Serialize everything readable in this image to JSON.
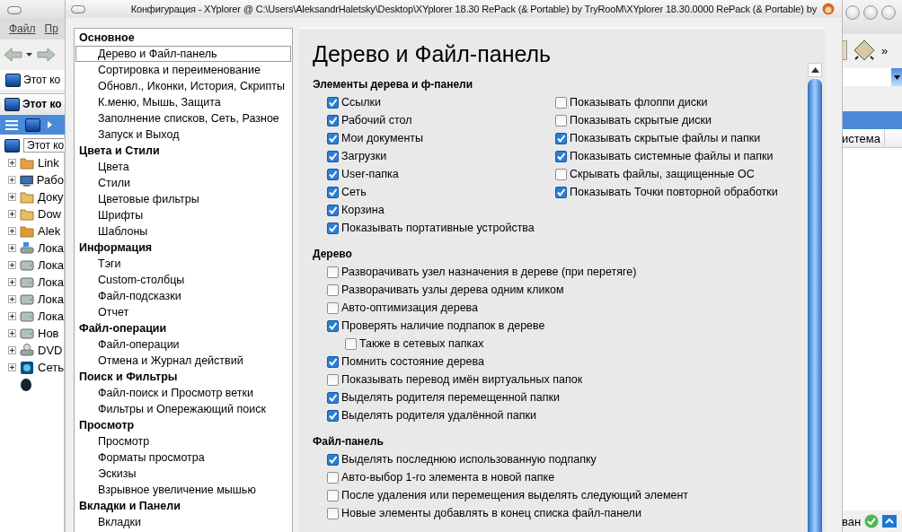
{
  "background_window": {
    "menu": [
      "Файл",
      "Пр"
    ],
    "address": "Этот ко",
    "tab": "Этот ко",
    "tree_root": "Этот ко",
    "tree": [
      {
        "label": "Link",
        "kind": "links"
      },
      {
        "label": "Рабо",
        "kind": "desktop"
      },
      {
        "label": "Доку",
        "kind": "documents"
      },
      {
        "label": "Dow",
        "kind": "downloads"
      },
      {
        "label": "Alek",
        "kind": "user"
      },
      {
        "label": "Лока",
        "kind": "system-drive"
      },
      {
        "label": "Лока",
        "kind": "drive"
      },
      {
        "label": "Лока",
        "kind": "drive"
      },
      {
        "label": "Лока",
        "kind": "drive"
      },
      {
        "label": "Лока",
        "kind": "drive"
      },
      {
        "label": "Нов",
        "kind": "drive"
      },
      {
        "label": "DVD",
        "kind": "dvd"
      },
      {
        "label": "Сеть",
        "kind": "network"
      }
    ],
    "toolbar_more": "»",
    "column_header": "истема",
    "status": "ван"
  },
  "dialog": {
    "title": "Конфигурация - XYplorer @ C:\\Users\\AleksandrHaletsky\\Desktop\\XYplorer 18.30 RePack (& Portable) by TryRooM\\XYplorer 18.30.0000 RePack (& Portable) by",
    "nav": [
      {
        "title": "Основное",
        "items": [
          {
            "label": "Дерево и Файл-панель",
            "selected": true
          },
          {
            "label": "Сортировка и переименование",
            "selected": false
          },
          {
            "label": "Обновл., Иконки, История, Скрипты",
            "selected": false
          },
          {
            "label": "К.меню, Мышь, Защита",
            "selected": false
          },
          {
            "label": "Заполнение списков, Сеть, Разное",
            "selected": false
          },
          {
            "label": "Запуск и Выход",
            "selected": false
          }
        ]
      },
      {
        "title": "Цвета и Стили",
        "items": [
          {
            "label": "Цвета",
            "selected": false
          },
          {
            "label": "Стили",
            "selected": false
          },
          {
            "label": "Цветовые фильтры",
            "selected": false
          },
          {
            "label": "Шрифты",
            "selected": false
          },
          {
            "label": "Шаблоны",
            "selected": false
          }
        ]
      },
      {
        "title": "Информация",
        "items": [
          {
            "label": "Тэги",
            "selected": false
          },
          {
            "label": "Custom-столбцы",
            "selected": false
          },
          {
            "label": "Файл-подсказки",
            "selected": false
          },
          {
            "label": "Отчет",
            "selected": false
          }
        ]
      },
      {
        "title": "Файл-операции",
        "items": [
          {
            "label": "Файл-операции",
            "selected": false
          },
          {
            "label": "Отмена и Журнал действий",
            "selected": false
          }
        ]
      },
      {
        "title": "Поиск и Фильтры",
        "items": [
          {
            "label": "Файл-поиск и Просмотр ветки",
            "selected": false
          },
          {
            "label": "Фильтры и Опережающий поиск",
            "selected": false
          }
        ]
      },
      {
        "title": "Просмотр",
        "items": [
          {
            "label": "Просмотр",
            "selected": false
          },
          {
            "label": "Форматы просмотра",
            "selected": false
          },
          {
            "label": "Эскизы",
            "selected": false
          },
          {
            "label": "Взрывное увеличение мышью",
            "selected": false
          }
        ]
      },
      {
        "title": "Вкладки и Панели",
        "items": [
          {
            "label": "Вкладки",
            "selected": false
          }
        ]
      }
    ],
    "heading": "Дерево и Файл-панель",
    "groups": [
      {
        "title": "Элементы дерева и ф-панели",
        "columns": [
          [
            {
              "label": "Ссылки",
              "checked": true
            },
            {
              "label": "Рабочий стол",
              "checked": true
            },
            {
              "label": "Мои документы",
              "checked": true
            },
            {
              "label": "Загрузки",
              "checked": true
            },
            {
              "label": "User-папка",
              "checked": true
            },
            {
              "label": "Сеть",
              "checked": true
            },
            {
              "label": "Корзина",
              "checked": true
            },
            {
              "label": "Показывать портативные устройства",
              "checked": true
            }
          ],
          [
            {
              "label": "Показывать флоппи диски",
              "checked": false
            },
            {
              "label": "Показывать скрытые диски",
              "checked": false
            },
            {
              "label": "Показывать скрытые файлы и папки",
              "checked": true
            },
            {
              "label": "Показывать системные файлы и папки",
              "checked": true
            },
            {
              "label": "Скрывать файлы, защищенные ОС",
              "checked": false
            },
            {
              "label": "Показывать Точки повторной обработки",
              "checked": true
            }
          ]
        ]
      },
      {
        "title": "Дерево",
        "columns": [
          [
            {
              "label": "Разворачивать узел назначения в дереве (при перетяге)",
              "checked": false
            },
            {
              "label": "Разворачивать узлы дерева одним кликом",
              "checked": false
            },
            {
              "label": "Авто-оптимизация дерева",
              "checked": false
            },
            {
              "label": "Проверять наличие подпапок в дереве",
              "checked": true,
              "children": [
                {
                  "label": "Также в сетевых папках",
                  "checked": false
                }
              ]
            },
            {
              "label": "Помнить состояние дерева",
              "checked": true
            },
            {
              "label": "Показывать перевод имён виртуальных папок",
              "checked": false
            },
            {
              "label": "Выделять родителя перемещенной папки",
              "checked": true
            },
            {
              "label": "Выделять родителя удалённой папки",
              "checked": true
            }
          ]
        ]
      },
      {
        "title": "Файл-панель",
        "columns": [
          [
            {
              "label": "Выделять последнюю использованную подпапку",
              "checked": true
            },
            {
              "label": "Авто-выбор 1-го элемента в новой папке",
              "checked": false
            },
            {
              "label": "После удаления или перемещения выделять следующий элемент",
              "checked": false
            },
            {
              "label": "Новые элементы добавлять в конец списка файл-панели",
              "checked": false
            }
          ]
        ]
      }
    ]
  }
}
